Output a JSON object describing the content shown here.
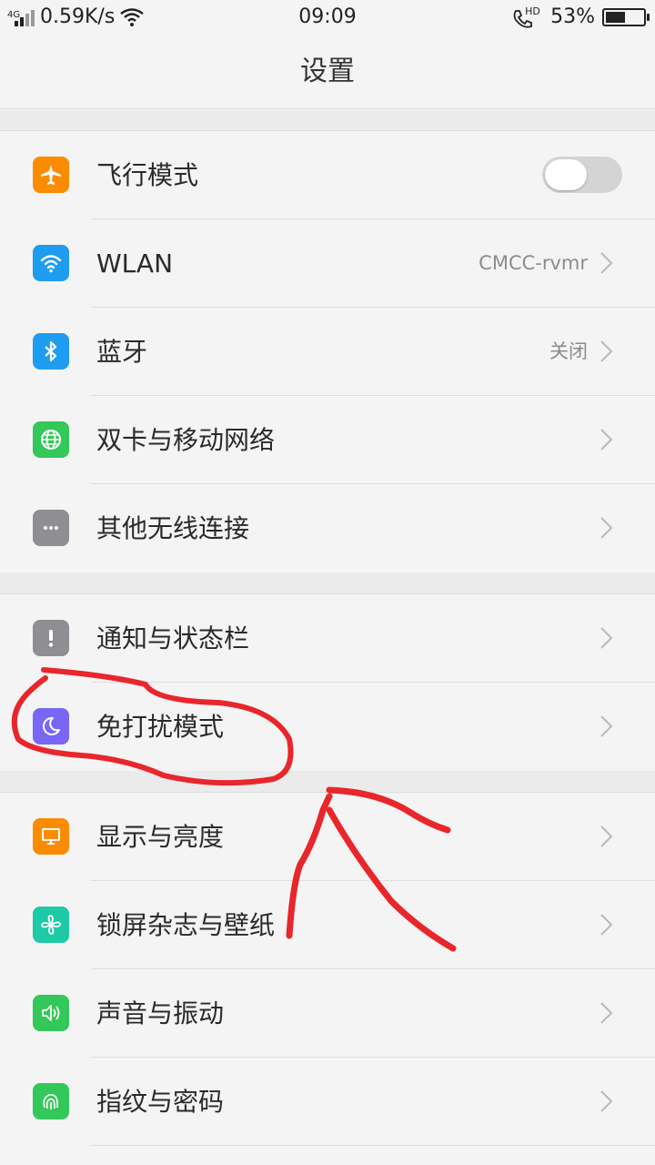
{
  "status_bar": {
    "network_type": "4G",
    "speed": "0.59K/s",
    "time": "09:09",
    "call_badge": "HD",
    "battery_percent": "53%",
    "battery_level": 0.53
  },
  "header": {
    "title": "设置"
  },
  "settings_groups": [
    {
      "items": [
        {
          "label": "飞行模式",
          "icon": "airplane-icon",
          "icon_color": "#fb8c00",
          "control": "toggle",
          "toggle_on": false
        },
        {
          "label": "WLAN",
          "icon": "wifi-icon",
          "icon_color": "#1e9cf0",
          "value": "CMCC-rvmr",
          "control": "chevron"
        },
        {
          "label": "蓝牙",
          "icon": "bluetooth-icon",
          "icon_color": "#1e9cf0",
          "value": "关闭",
          "control": "chevron"
        },
        {
          "label": "双卡与移动网络",
          "icon": "globe-icon",
          "icon_color": "#34c759",
          "control": "chevron"
        },
        {
          "label": "其他无线连接",
          "icon": "more-dots-icon",
          "icon_color": "#8e8e93",
          "control": "chevron"
        }
      ]
    },
    {
      "items": [
        {
          "label": "通知与状态栏",
          "icon": "exclamation-icon",
          "icon_color": "#8e8e93",
          "control": "chevron"
        },
        {
          "label": "免打扰模式",
          "icon": "moon-icon",
          "icon_color": "#7a66f5",
          "control": "chevron"
        }
      ]
    },
    {
      "items": [
        {
          "label": "显示与亮度",
          "icon": "display-icon",
          "icon_color": "#fb8c00",
          "control": "chevron"
        },
        {
          "label": "锁屏杂志与壁纸",
          "icon": "pinwheel-icon",
          "icon_color": "#1ec9a6",
          "control": "chevron"
        },
        {
          "label": "声音与振动",
          "icon": "speaker-icon",
          "icon_color": "#34c759",
          "control": "chevron"
        },
        {
          "label": "指纹与密码",
          "icon": "fingerprint-icon",
          "icon_color": "#34c759",
          "control": "chevron"
        }
      ]
    }
  ],
  "annotation": {
    "stroke_color": "#e8262b",
    "shapes": [
      "circle-around-do-not-disturb",
      "arrow-pointing-up"
    ]
  }
}
